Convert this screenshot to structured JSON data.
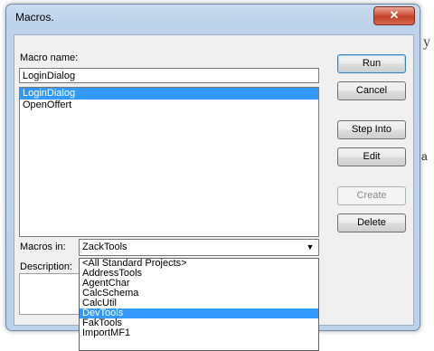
{
  "window": {
    "title": "Macros.",
    "close_glyph": "✕"
  },
  "form": {
    "macro_name_label": "Macro name:",
    "macro_name_value": "LoginDialog",
    "macros_in_label": "Macros in:",
    "macros_in_value": "ZackTools",
    "description_label": "Description:"
  },
  "macro_list": [
    {
      "label": "LoginDialog",
      "selected": true
    },
    {
      "label": "OpenOffert",
      "selected": false
    }
  ],
  "buttons": {
    "run": "Run",
    "cancel": "Cancel",
    "step_into": "Step Into",
    "edit": "Edit",
    "create": "Create",
    "delete": "Delete"
  },
  "dropdown_options": [
    {
      "label": "<All Standard Projects>",
      "selected": false
    },
    {
      "label": "AddressTools",
      "selected": false
    },
    {
      "label": "AgentChar",
      "selected": false
    },
    {
      "label": "CalcSchema",
      "selected": false
    },
    {
      "label": "CalcUtil",
      "selected": false
    },
    {
      "label": "DevTools",
      "selected": true
    },
    {
      "label": "FakTools",
      "selected": false
    },
    {
      "label": "ImportMF1",
      "selected": false
    }
  ],
  "icons": {
    "combo_arrow": "▼"
  },
  "colors": {
    "selection": "#3399ff",
    "close_button": "#c43f28",
    "frame": "#b9d1ea"
  }
}
